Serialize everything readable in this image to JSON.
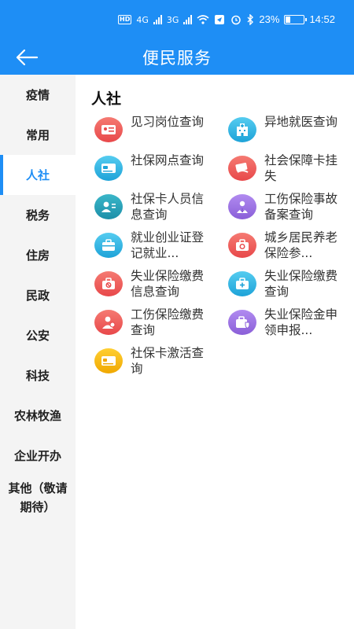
{
  "status_bar": {
    "network_1": "4G",
    "network_2": "3G",
    "battery": "23%",
    "battery_level": 0.23,
    "time": "14:52"
  },
  "header": {
    "title": "便民服务"
  },
  "sidebar": {
    "items": [
      {
        "label": "疫情"
      },
      {
        "label": "常用"
      },
      {
        "label": "人社"
      },
      {
        "label": "税务"
      },
      {
        "label": "住房"
      },
      {
        "label": "民政"
      },
      {
        "label": "公安"
      },
      {
        "label": "科技"
      },
      {
        "label": "农林牧渔"
      },
      {
        "label": "企业开办"
      },
      {
        "label": "其他（敬请期待）"
      }
    ],
    "active_index": 2
  },
  "section": {
    "title": "人社",
    "services": [
      {
        "label": "见习岗位查询",
        "icon": "id-card-icon",
        "color": "#f0605a"
      },
      {
        "label": "异地就医查询",
        "icon": "hospital-icon",
        "color": "#2fb4e0"
      },
      {
        "label": "社保网点查询",
        "icon": "card-icon",
        "color": "#2fb4e0"
      },
      {
        "label": "社会保障卡挂失",
        "icon": "card-lost-icon",
        "color": "#f0605a"
      },
      {
        "label": "社保卡人员信息查询",
        "icon": "person-info-icon",
        "color": "#2fb4e0"
      },
      {
        "label": "工伤保险事故备案查询",
        "icon": "injury-icon",
        "color": "#9b6fe0"
      },
      {
        "label": "就业创业证登记就业...",
        "icon": "briefcase-icon",
        "color": "#2fb4e0"
      },
      {
        "label": "城乡居民养老保险参...",
        "icon": "pension-icon",
        "color": "#f0605a"
      },
      {
        "label": "失业保险缴费信息查询",
        "icon": "forbidden-case-icon",
        "color": "#f0605a"
      },
      {
        "label": "失业保险缴费查询",
        "icon": "medical-case-icon",
        "color": "#2fb4e0"
      },
      {
        "label": "工伤保险缴费查询",
        "icon": "worker-icon",
        "color": "#f0605a"
      },
      {
        "label": "失业保险金申领申报...",
        "icon": "shield-case-icon",
        "color": "#9b6fe0"
      },
      {
        "label": "社保卡激活查询",
        "icon": "sim-card-icon",
        "color": "#f5b400"
      }
    ]
  }
}
